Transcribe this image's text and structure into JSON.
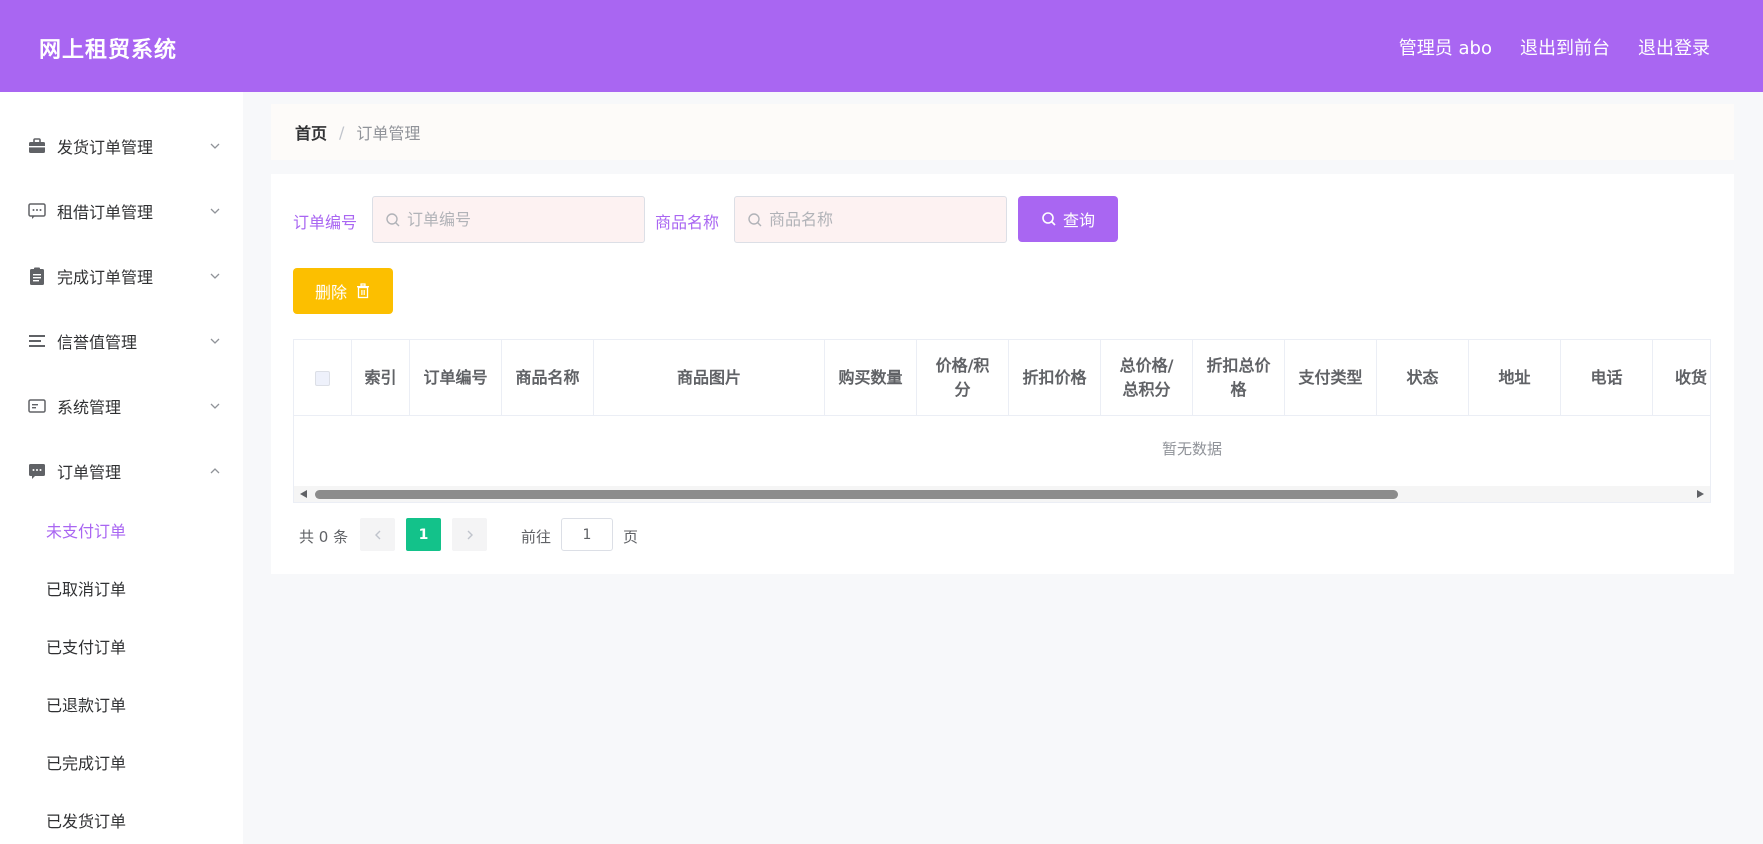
{
  "header": {
    "brand": "网上租贸系统",
    "nav": [
      "管理员 abo",
      "退出到前台",
      "退出登录"
    ]
  },
  "sidebar": {
    "menus": [
      {
        "label": "发货订单管理",
        "icon": "briefcase-icon",
        "expanded": false
      },
      {
        "label": "租借订单管理",
        "icon": "chat-icon",
        "expanded": false
      },
      {
        "label": "完成订单管理",
        "icon": "clipboard-icon",
        "expanded": false
      },
      {
        "label": "信誉值管理",
        "icon": "list-icon",
        "expanded": false
      },
      {
        "label": "系统管理",
        "icon": "card-icon",
        "expanded": false
      },
      {
        "label": "订单管理",
        "icon": "message-icon",
        "expanded": true
      }
    ],
    "submenu": [
      "未支付订单",
      "已取消订单",
      "已支付订单",
      "已退款订单",
      "已完成订单",
      "已发货订单"
    ],
    "active_submenu": "未支付订单"
  },
  "breadcrumb": {
    "home": "首页",
    "separator": "/",
    "current": "订单管理"
  },
  "search": {
    "order_no_label": "订单编号",
    "order_no_placeholder": "订单编号",
    "product_label": "商品名称",
    "product_placeholder": "商品名称",
    "query_label": "查询"
  },
  "actions": {
    "delete_label": "删除"
  },
  "table": {
    "columns": [
      "索引",
      "订单编号",
      "商品名称",
      "商品图片",
      "购买数量",
      "价格/积\n分",
      "折扣价格",
      "总价格/\n总积分",
      "折扣总价\n格",
      "支付类型",
      "状态",
      "地址",
      "电话",
      "收货"
    ],
    "empty_text": "暂无数据"
  },
  "pagination": {
    "total_text": "共 0 条",
    "current_page": "1",
    "goto_label": "前往",
    "goto_value": "1",
    "page_unit": "页"
  },
  "colors": {
    "accent": "#a966f2",
    "warning": "#fcbf00",
    "page_active": "#13c28a"
  }
}
